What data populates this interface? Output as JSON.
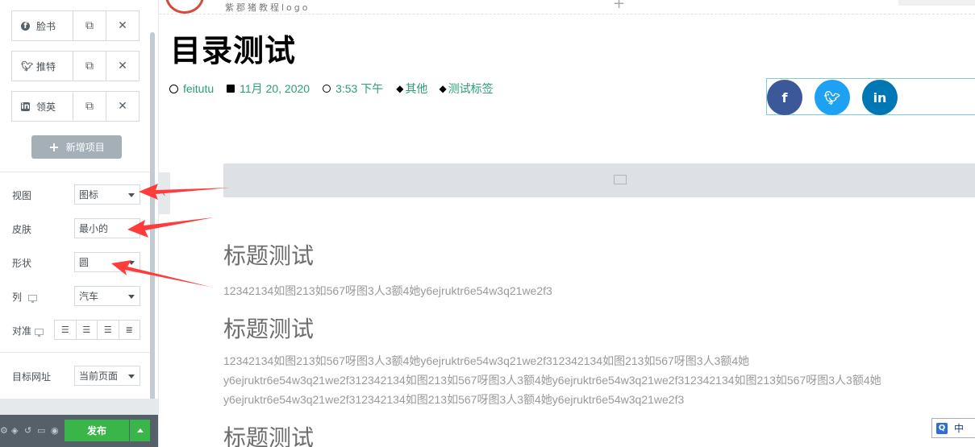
{
  "panel": {
    "repeater_items": [
      {
        "label": "脸书",
        "icon": "facebook-icon"
      },
      {
        "label": "推特",
        "icon": "twitter-icon"
      },
      {
        "label": "领英",
        "icon": "linkedin-icon"
      }
    ],
    "add_item_label": "新增项目",
    "controls": {
      "view": {
        "label": "视图",
        "value": "图标"
      },
      "skin": {
        "label": "皮肤",
        "value": "最小的"
      },
      "shape": {
        "label": "形状",
        "value": "圆"
      },
      "columns": {
        "label": "列",
        "value": "汽车"
      },
      "align": {
        "label": "对准"
      },
      "target_url": {
        "label": "目标网址",
        "value": "当前页面"
      }
    },
    "publish_label": "发布"
  },
  "canvas": {
    "logo_text": "紫郡猪教程logo",
    "post_title": "目录测试",
    "meta": {
      "author": "feitutu",
      "date": "11月 20, 2020",
      "time": "3:53 下午",
      "category": "其他",
      "tag": "测试标签"
    },
    "share_buttons": [
      {
        "icon": "facebook-icon",
        "color": "#3b5998"
      },
      {
        "icon": "twitter-icon",
        "color": "#1da1f2"
      },
      {
        "icon": "linkedin-icon",
        "color": "#0077b5"
      }
    ],
    "sections": [
      {
        "heading": "标题测试",
        "lines": [
          "12342134如图213如567呀图3人3额4她y6ejruktr6e54w3q21we2f3"
        ]
      },
      {
        "heading": "标题测试",
        "lines": [
          "12342134如图213如567呀图3人3额4她y6ejruktr6e54w3q21we2f312342134如图213如567呀图3人3额4她",
          "y6ejruktr6e54w3q21we2f312342134如图213如567呀图3人3额4她y6ejruktr6e54w3q21we2f312342134如图213如567呀图3人3额4她",
          "y6ejruktr6e54w3q21we2f312342134如图213如567呀图3人3额4她y6ejruktr6e54w3q21we2f3"
        ]
      },
      {
        "heading": "标题测试",
        "lines": []
      }
    ]
  },
  "ime": {
    "logo": "Q",
    "mode": "中"
  },
  "colors": {
    "accent": "#2c9c7a",
    "publish": "#39b54a",
    "arrow": "#ff3b3b"
  }
}
